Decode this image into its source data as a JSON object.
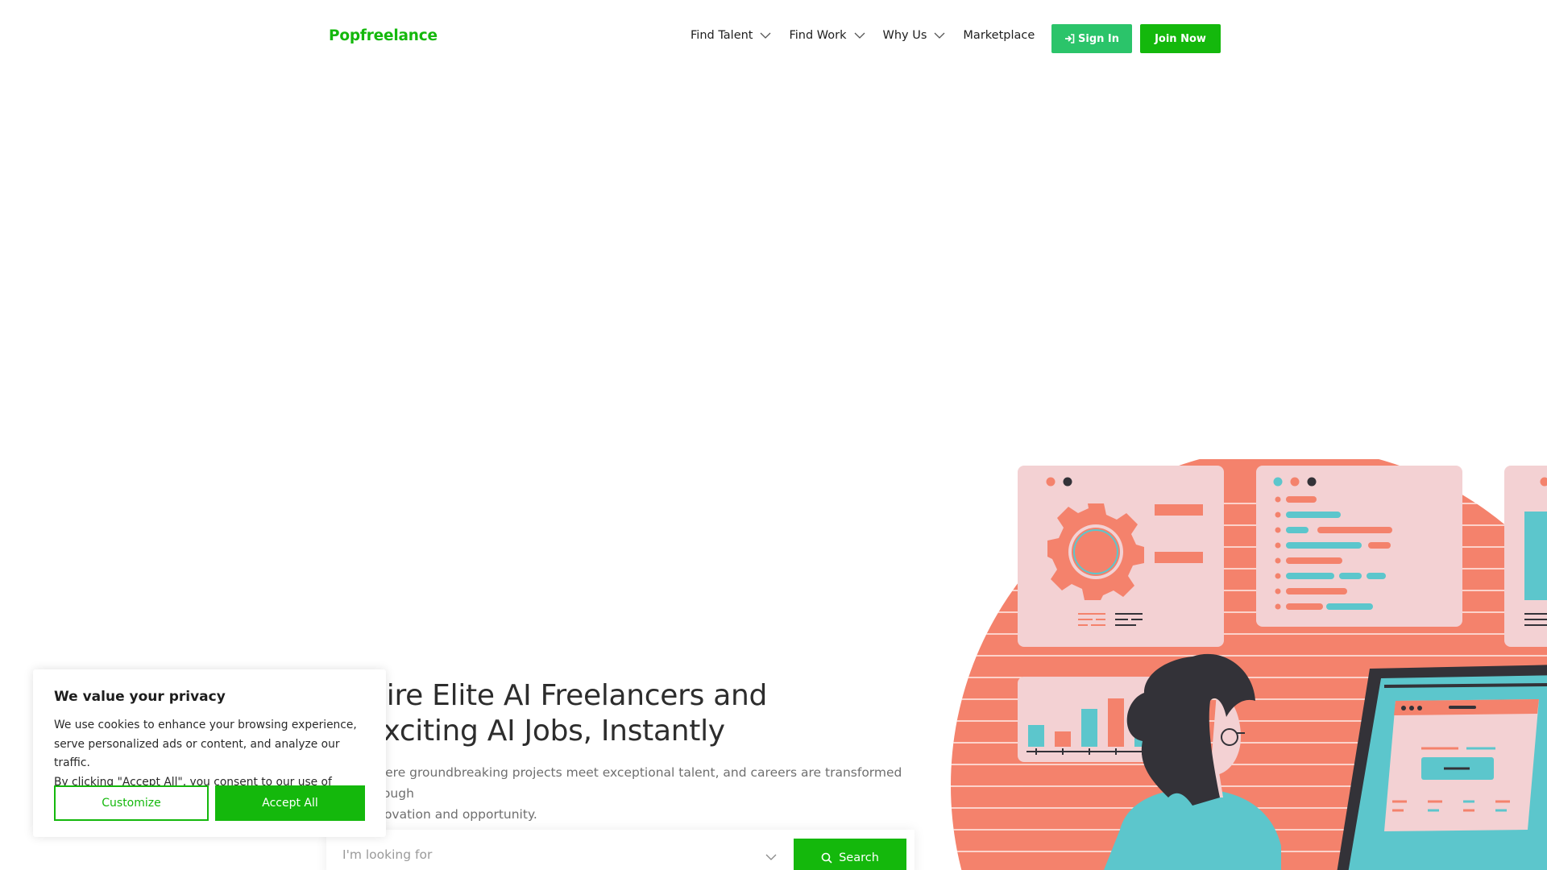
{
  "header": {
    "logo": "Popfreelance",
    "nav": [
      {
        "label": "Find Talent",
        "has_dropdown": true
      },
      {
        "label": "Find Work",
        "has_dropdown": true
      },
      {
        "label": "Why Us",
        "has_dropdown": true
      },
      {
        "label": "Marketplace",
        "has_dropdown": false
      }
    ],
    "signin_label": "Sign In",
    "join_label": "Join Now"
  },
  "hero": {
    "title_line1": "Hire Elite AI Freelancers and",
    "title_line2": "Exciting AI Jobs, Instantly",
    "subtitle_line1": "Where groundbreaking projects meet exceptional talent, and careers are transformed through",
    "subtitle_line2": "innovation and opportunity."
  },
  "search": {
    "placeholder": "I'm looking for",
    "button_label": "Search"
  },
  "cookie": {
    "title": "We value your privacy",
    "text_line1": "We use cookies to enhance your browsing experience,",
    "text_line2": "serve personalized ads or content, and analyze our traffic.",
    "text_line3": "By clicking \"Accept All\", you consent to our use of cookies.",
    "customize_label": "Customize",
    "accept_label": "Accept All"
  },
  "colors": {
    "brand_green": "#14b80c",
    "signin_green": "#2bc46a",
    "coral": "#f4826c",
    "pink_panel": "#f3d1d3",
    "teal": "#5cc6cc",
    "dark": "#333238"
  }
}
